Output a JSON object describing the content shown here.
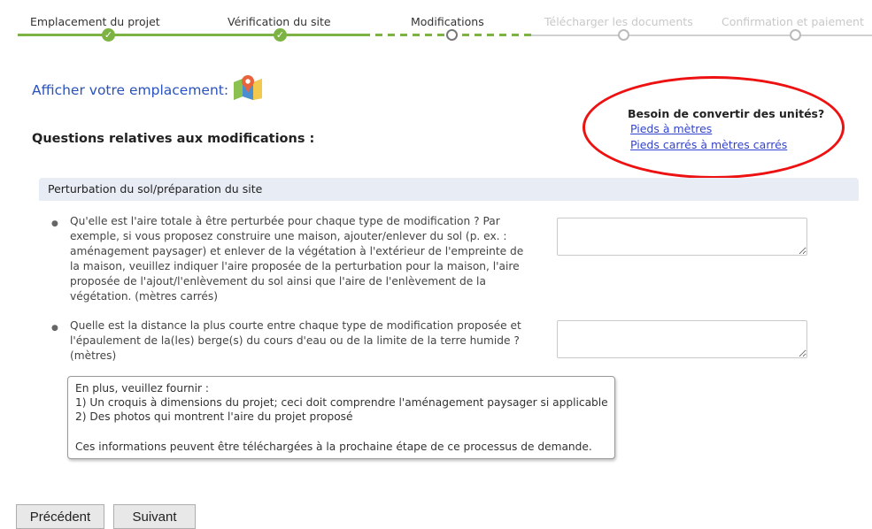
{
  "stepper": {
    "steps": [
      {
        "label": "Emplacement du projet",
        "state": "done"
      },
      {
        "label": "Vérification du site",
        "state": "done"
      },
      {
        "label": "Modifications",
        "state": "current"
      },
      {
        "label": "Télécharger les documents",
        "state": "future"
      },
      {
        "label": "Confirmation et paiement",
        "state": "future"
      }
    ],
    "check_glyph": "✓",
    "colors": {
      "done": "#7cb342",
      "future": "#c8c8c8"
    }
  },
  "location": {
    "label": "Afficher votre emplacement:",
    "icon": "map-pin-icon"
  },
  "questions_title": "Questions relatives aux modifications :",
  "converter": {
    "title": "Besoin de convertir des unités?",
    "links": [
      "Pieds à mètres",
      "Pieds carrés à mètres carrés"
    ],
    "highlight_color": "#ee1111"
  },
  "section": {
    "title": "Perturbation du sol/préparation du site"
  },
  "fields": [
    {
      "lines": [
        "Qu'elle est l'aire totale à être perturbée pour chaque type de modification ? Par",
        "exemple, si vous proposez construire une maison, ajouter/enlever du sol (p. ex. :",
        "aménagement paysager) et enlever de la végétation à l'extérieur de l'empreinte de",
        "la maison, veuillez indiquer l'aire proposée de la perturbation pour la maison, l'aire",
        "proposée de l'ajout/l'enlèvement du sol ainsi que l'aire de l'enlèvement de la",
        "végétation. (mètres carrés)"
      ],
      "value": ""
    },
    {
      "lines": [
        "Quelle est la distance la plus courte entre chaque type de modification proposée et",
        "l'épaulement de la(les) berge(s) du cours d'eau ou de la limite de la terre humide ?",
        "(mètres)"
      ],
      "value": ""
    }
  ],
  "info": {
    "lines": [
      "En plus, veuillez fournir :",
      "1) Un croquis à dimensions du projet; ceci doit comprendre l'aménagement paysager si applicable",
      "2) Des photos qui montrent l'aire du projet proposé",
      "",
      "Ces informations peuvent être téléchargées à la prochaine étape de ce processus de demande."
    ]
  },
  "buttons": {
    "previous": "Précédent",
    "next": "Suivant"
  }
}
